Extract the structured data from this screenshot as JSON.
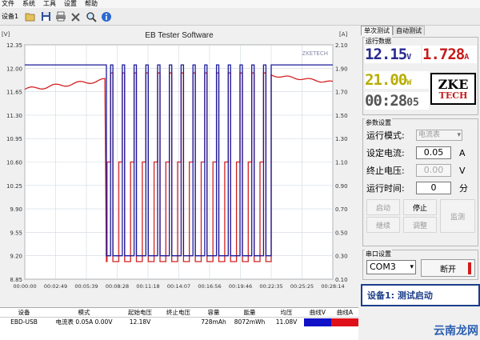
{
  "menu": [
    "文件",
    "系统",
    "工具",
    "设置",
    "帮助"
  ],
  "toolbar": {
    "device_label": "设备1"
  },
  "chart": {
    "title": "EB Tester Software",
    "watermark": "ZKETECH",
    "left_unit": "[V]",
    "right_unit": "[A]",
    "left_ticks": [
      "12.35",
      "12.00",
      "11.65",
      "11.30",
      "10.95",
      "10.60",
      "10.25",
      "9.90",
      "9.55",
      "9.20",
      "8.85"
    ],
    "right_ticks": [
      "2.10",
      "1.90",
      "1.70",
      "1.50",
      "1.30",
      "1.10",
      "0.90",
      "0.70",
      "0.50",
      "0.30",
      "0.10"
    ],
    "x_ticks": [
      "00:00:00",
      "00:02:49",
      "00:05:39",
      "00:08:28",
      "00:11:18",
      "00:14:07",
      "00:16:56",
      "00:19:46",
      "00:22:35",
      "00:25:25",
      "00:28:14"
    ]
  },
  "chart_data": {
    "type": "line",
    "title": "EB Tester Software",
    "xlabel": "",
    "ylabel": "[V]",
    "y2label": "[A]",
    "ylim": [
      8.85,
      12.35
    ],
    "y2lim": [
      0.1,
      2.1
    ],
    "x": [
      "00:00:00",
      "00:02:49",
      "00:05:39",
      "00:08:28",
      "00:11:18",
      "00:14:07",
      "00:16:56",
      "00:19:46",
      "00:22:35",
      "00:25:25",
      "00:28:14"
    ],
    "series": [
      {
        "name": "曲线V",
        "axis": "left",
        "color": "#1a1a9c",
        "pattern": "12.05 V until ~00:05:00, then alternating 12.05 V / 9.20 V square pulses (~14 cycles) until ~00:22:35, then 12.05 V"
      },
      {
        "name": "曲线A",
        "axis": "right",
        "color": "#d42020",
        "pattern": "~1.75 A rising to ~1.85 A when at rest, dropping to ~0.25 A during each pulse, ~1.10 A on plateaus"
      }
    ]
  },
  "tabs": [
    "单次测试",
    "自动测试"
  ],
  "run_data": {
    "title": "运行数据",
    "voltage": "12.15",
    "voltage_unit": "V",
    "current": "1.728",
    "current_unit": "A",
    "power": "21.00",
    "power_unit": "W",
    "time": "00:28",
    "time_unit": "05",
    "logo_top": "ZKE",
    "logo_bottom": "TECH"
  },
  "params": {
    "title": "参数设置",
    "mode_label": "运行模式:",
    "mode_value": "电流表",
    "current_label": "设定电流:",
    "current_value": "0.05",
    "current_unit": "A",
    "voltage_label": "终止电压:",
    "voltage_value": "0.00",
    "voltage_unit": "V",
    "time_label": "运行时间:",
    "time_value": "0",
    "time_unit": "分"
  },
  "buttons": {
    "start": "启动",
    "stop": "停止",
    "cont": "继续",
    "adjust": "调整",
    "monitor": "监测"
  },
  "serial": {
    "title": "串口设置",
    "port": "COM3",
    "disconnect": "断开"
  },
  "status": {
    "text": "设备1: 测试启动"
  },
  "watermark_site": "云南龙网",
  "table": {
    "headers": [
      "设备",
      "模式",
      "起始电压",
      "终止电压",
      "容量",
      "能量",
      "均压",
      "曲线V",
      "曲线A"
    ],
    "row": [
      "EBD-USB",
      "电流表  0.05A  0.00V",
      "12.18V",
      "",
      "728mAh",
      "8072mWh",
      "11.08V",
      "",
      ""
    ],
    "curve_v_color": "#1010c8",
    "curve_a_color": "#e0101a"
  }
}
